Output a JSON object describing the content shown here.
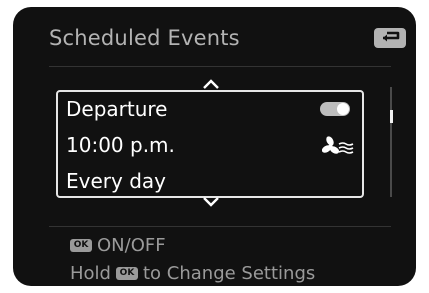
{
  "screen": {
    "title": "Scheduled Events",
    "back_icon": "return-arrow-icon"
  },
  "event": {
    "name": "Departure",
    "time": "10:00  p.m.",
    "repeat": "Every day",
    "enabled": true,
    "mode_icon": "fan-icon"
  },
  "scroll": {
    "up_icon": "chevron-up-icon",
    "down_icon": "chevron-down-icon"
  },
  "hints": {
    "ok_badge": "OK",
    "line1": "ON/OFF",
    "line2_prefix": "Hold",
    "line2_suffix": "to Change Settings"
  },
  "colors": {
    "background": "#111111",
    "title": "#b3b3b3",
    "text": "#ffffff",
    "hint": "#9a9a9a"
  }
}
